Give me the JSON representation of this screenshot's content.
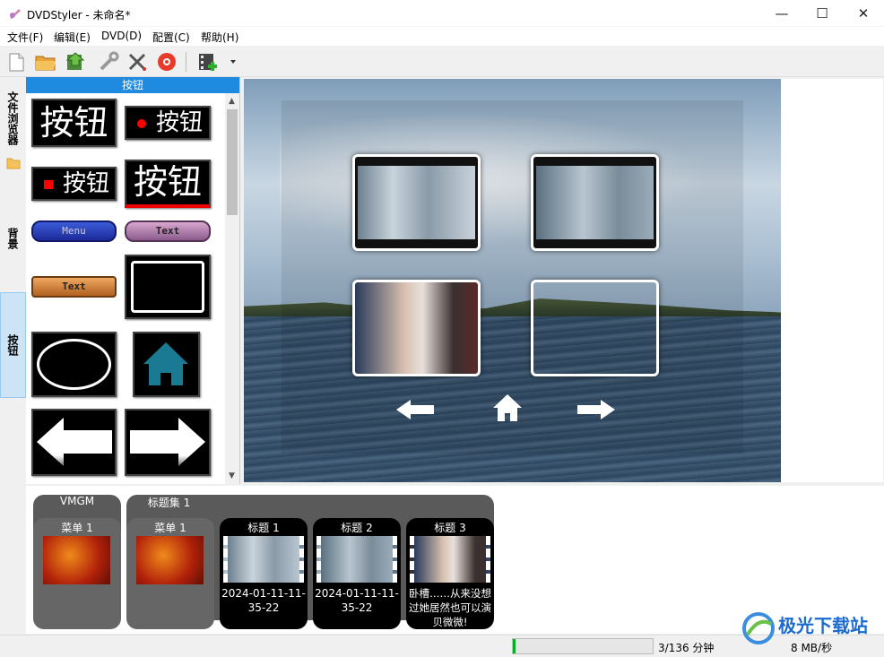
{
  "window": {
    "title": "DVDStyler - 未命名*",
    "minimize": "—",
    "maximize": "☐",
    "close": "✕"
  },
  "menu": [
    "文件(F)",
    "编辑(E)",
    "DVD(D)",
    "配置(C)",
    "帮助(H)"
  ],
  "toolbar": {
    "icons": [
      "new-icon",
      "open-icon",
      "save-icon",
      "settings-icon",
      "tools-icon",
      "burn-icon",
      "add-file-icon",
      "dropdown-icon"
    ]
  },
  "sidetabs": {
    "file_browser": "文件浏览器",
    "background": "背景",
    "buttons": "按钮"
  },
  "panel": {
    "header": "按钮",
    "buttons_text": [
      "按钮",
      "按钮",
      "按钮",
      "按钮"
    ],
    "menu_btn": "Menu",
    "text_btn": "Text",
    "text_btn2": "Text"
  },
  "bottom": {
    "vmgm": "VMGM",
    "vmgm_menu": "菜单 1",
    "titleset": "标题集 1",
    "titleset_menu": "菜单 1",
    "titles": [
      {
        "label": "标题 1",
        "caption": "2024-01-11-11-35-22"
      },
      {
        "label": "标题 2",
        "caption": "2024-01-11-11-35-22"
      },
      {
        "label": "标题 3",
        "caption": "卧槽……从来没想过她居然也可以演贝微微!"
      }
    ]
  },
  "status": {
    "progress": 0.02,
    "count": "3/136 分钟",
    "rate": "8 MB/秒"
  },
  "watermark": "极光下载站"
}
